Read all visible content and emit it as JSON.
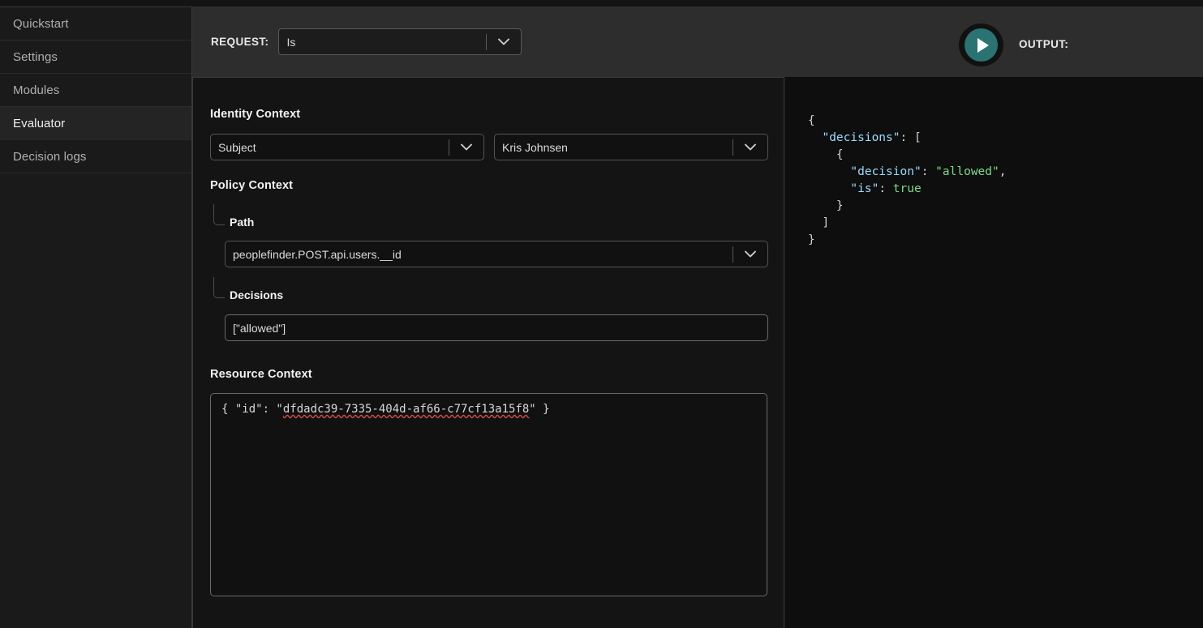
{
  "sidebar": {
    "items": [
      {
        "label": "Quickstart",
        "active": false
      },
      {
        "label": "Settings",
        "active": false
      },
      {
        "label": "Modules",
        "active": false
      },
      {
        "label": "Evaluator",
        "active": true
      },
      {
        "label": "Decision logs",
        "active": false
      }
    ]
  },
  "header": {
    "request_label": "REQUEST:",
    "request_value": "Is",
    "run_icon": "play-icon",
    "output_label": "OUTPUT:"
  },
  "form": {
    "identity_context": {
      "title": "Identity Context",
      "type_value": "Subject",
      "identity_value": "Kris Johnsen"
    },
    "policy_context": {
      "title": "Policy Context",
      "path_label": "Path",
      "path_value": "peoplefinder.POST.api.users.__id",
      "decisions_label": "Decisions",
      "decisions_value": "[\"allowed\"]"
    },
    "resource_context": {
      "title": "Resource Context",
      "prefix": "{ \"id\": \"",
      "uuid": "dfdadc39-7335-404d-af66-c77cf13a15f8",
      "suffix": "\" }"
    }
  },
  "output": {
    "lines": [
      {
        "indent": 0,
        "segments": [
          {
            "t": "{",
            "c": "punct"
          }
        ]
      },
      {
        "indent": 1,
        "segments": [
          {
            "t": "\"decisions\"",
            "c": "key"
          },
          {
            "t": ": [",
            "c": "punct"
          }
        ]
      },
      {
        "indent": 2,
        "segments": [
          {
            "t": "{",
            "c": "punct"
          }
        ]
      },
      {
        "indent": 3,
        "segments": [
          {
            "t": "\"decision\"",
            "c": "key"
          },
          {
            "t": ": ",
            "c": "punct"
          },
          {
            "t": "\"allowed\"",
            "c": "str"
          },
          {
            "t": ",",
            "c": "punct"
          }
        ]
      },
      {
        "indent": 3,
        "segments": [
          {
            "t": "\"is\"",
            "c": "key"
          },
          {
            "t": ": ",
            "c": "punct"
          },
          {
            "t": "true",
            "c": "bool"
          }
        ]
      },
      {
        "indent": 2,
        "segments": [
          {
            "t": "}",
            "c": "punct"
          }
        ]
      },
      {
        "indent": 1,
        "segments": [
          {
            "t": "]",
            "c": "punct"
          }
        ]
      },
      {
        "indent": 0,
        "segments": [
          {
            "t": "}",
            "c": "punct"
          }
        ]
      }
    ]
  },
  "colors": {
    "accent": "#2b7272",
    "json_key": "#9cdcfe",
    "json_string": "#7ddb8a",
    "sidebar_bg": "#1a1a1a",
    "header_bg": "#2d2d2d",
    "page_bg": "#141414",
    "spellcheck_underline": "#d24b4b"
  }
}
